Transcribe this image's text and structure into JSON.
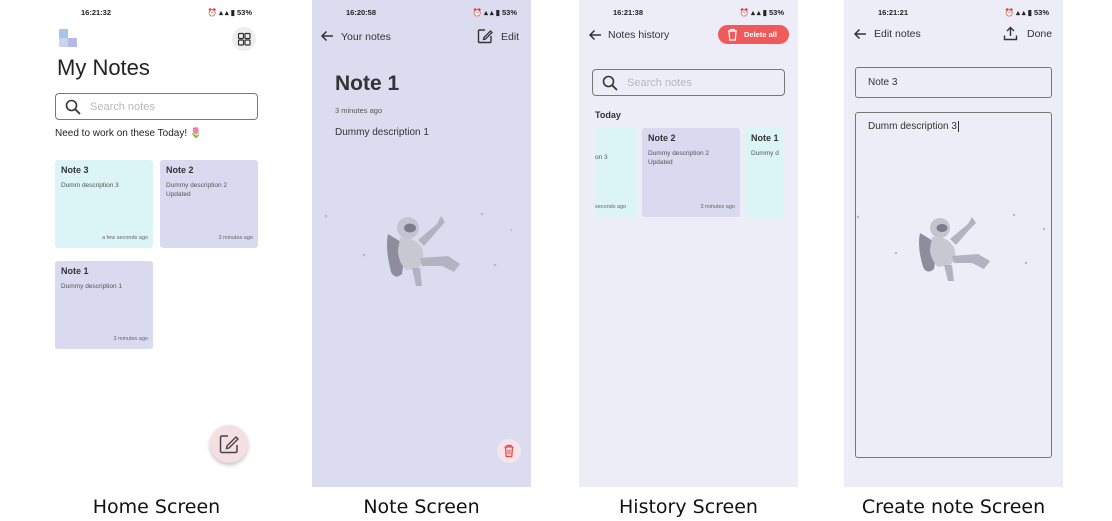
{
  "colors": {
    "teal_card": "#dbf4f6",
    "lavender_card": "#d9d9f0",
    "note_bg": "#dcdcf1",
    "history_bg": "#ecedf7",
    "danger": "#f05a5a"
  },
  "home": {
    "status_time": "16:21:32",
    "battery": "53%",
    "title": "My Notes",
    "search_placeholder": "Search notes",
    "reminder": "Need to work on these Today!",
    "notes": [
      {
        "title": "Note 3",
        "description": "Dumm description 3",
        "time": "a few seconds ago"
      },
      {
        "title": "Note 2",
        "description": "Dummy description 2 Updated",
        "time": "3 minutes ago"
      },
      {
        "title": "Note 1",
        "description": "Dummy description 1",
        "time": "3 minutes ago"
      }
    ],
    "caption": "Home Screen"
  },
  "note": {
    "status_time": "16:20:58",
    "battery": "53%",
    "back_label": "Your notes",
    "edit_label": "Edit",
    "title": "Note 1",
    "time": "3 minutes ago",
    "description": "Dummy description 1",
    "caption": "Note Screen"
  },
  "history": {
    "status_time": "16:21:38",
    "battery": "53%",
    "back_label": "Notes history",
    "delete_all_label": "Delete all",
    "search_placeholder": "Search notes",
    "section_label": "Today",
    "cards": [
      {
        "title": "",
        "description": "on 3",
        "time": "seconds ago"
      },
      {
        "title": "Note 2",
        "description": "Dummy description 2 Updated",
        "time": "3 minutes ago"
      },
      {
        "title": "Note 1",
        "description": "Dummy d",
        "time": ""
      }
    ],
    "caption": "History Screen"
  },
  "create": {
    "status_time": "16:21:21",
    "battery": "53%",
    "back_label": "Edit notes",
    "done_label": "Done",
    "title_value": "Note 3",
    "description_value": "Dumm description 3",
    "caption": "Create note Screen"
  }
}
